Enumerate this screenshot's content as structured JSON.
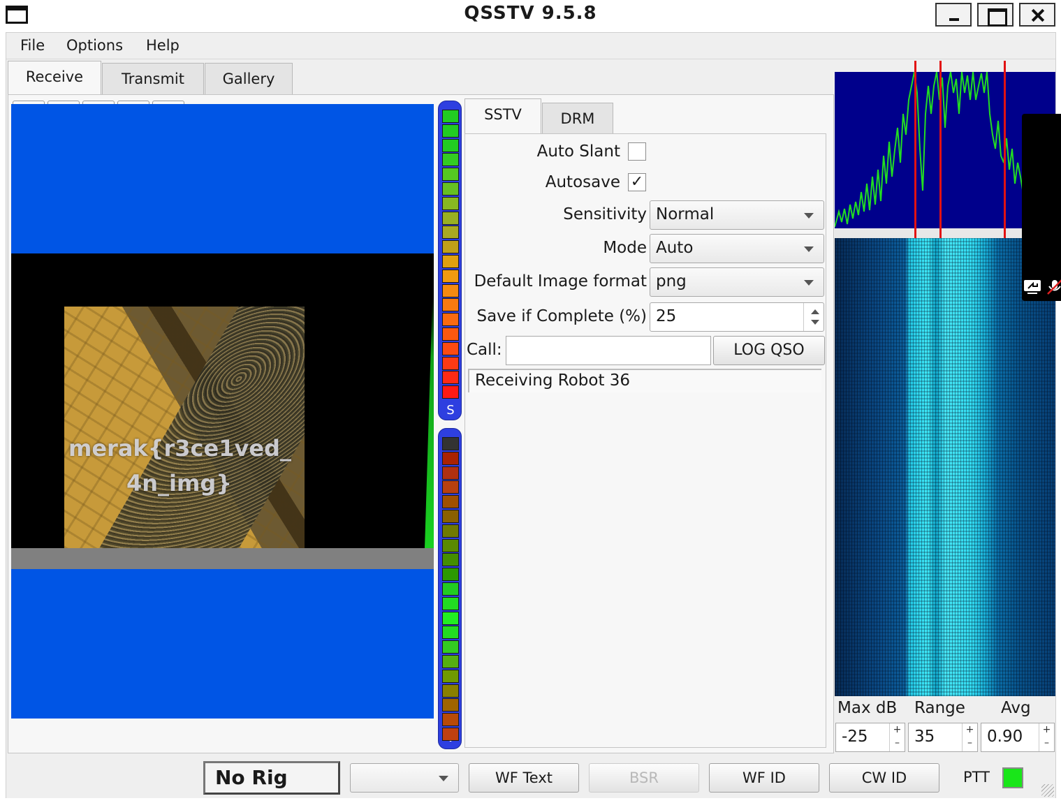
{
  "window": {
    "title": "QSSTV 9.5.8"
  },
  "menu": [
    "File",
    "Options",
    "Help"
  ],
  "main_tabs": [
    "Receive",
    "Transmit",
    "Gallery"
  ],
  "toolbar": [
    "start-icon",
    "stop-icon",
    "resync-icon",
    "save-icon",
    "erase-icon"
  ],
  "image": {
    "line1": "merak{r3ce1ved_",
    "line2": "4n_img}"
  },
  "meters": {
    "signal_label": "S",
    "volume_label": "V"
  },
  "sstv_tabs": [
    "SSTV",
    "DRM"
  ],
  "settings": {
    "auto_slant": {
      "label": "Auto Slant",
      "checked": false,
      "mark": ""
    },
    "autosave": {
      "label": "Autosave",
      "checked": true,
      "mark": "✓"
    },
    "sensitivity": {
      "label": "Sensitivity",
      "value": "Normal"
    },
    "mode": {
      "label": "Mode",
      "value": "Auto"
    },
    "image_format": {
      "label": "Default Image format",
      "value": "png"
    },
    "save_complete": {
      "label": "Save if Complete (%)",
      "value": "25"
    },
    "call": {
      "label": "Call:",
      "value": ""
    },
    "log_button": "LOG QSO",
    "status": "Receiving Robot 36"
  },
  "waterfall": {
    "max_db": {
      "label": "Max dB",
      "value": "-25"
    },
    "range": {
      "label": "Range",
      "value": "35"
    },
    "avg": {
      "label": "Avg",
      "value": "0.90"
    },
    "spin_plus": "+",
    "spin_minus": "–"
  },
  "bottom": {
    "rig": "No Rig",
    "combo_value": "",
    "wf_text": "WF Text",
    "bsr": "BSR",
    "wf_id": "WF ID",
    "cw_id": "CW ID",
    "ptt": "PTT",
    "ptt_color": "#19e619"
  }
}
